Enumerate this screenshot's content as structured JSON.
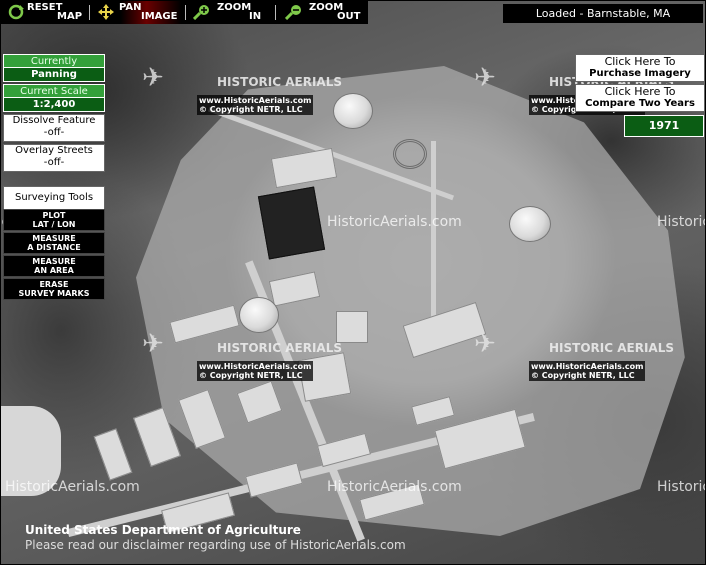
{
  "toolbar": {
    "reset": {
      "line1": "RESET",
      "line2": "MAP"
    },
    "pan": {
      "line1": "PAN",
      "line2": "IMAGE"
    },
    "zoom_in": {
      "line1": "ZOOM",
      "line2": "IN"
    },
    "zoom_out": {
      "line1": "ZOOM",
      "line2": "OUT"
    }
  },
  "status": {
    "loaded": "Loaded - Barnstable, MA"
  },
  "left_panel": {
    "currently_label": "Currently",
    "currently_value": "Panning",
    "scale_label": "Current Scale",
    "scale_value": "1:2,400",
    "dissolve_label": "Dissolve Feature",
    "dissolve_value": "-off-",
    "streets_label": "Overlay Streets",
    "streets_value": "-off-",
    "surveying_label": "Surveying Tools",
    "tools": [
      {
        "line1": "PLOT",
        "line2": "LAT / LON"
      },
      {
        "line1": "MEASURE",
        "line2": "A DISTANCE"
      },
      {
        "line1": "MEASURE",
        "line2": "AN AREA"
      },
      {
        "line1": "ERASE",
        "line2": "SURVEY MARKS"
      }
    ]
  },
  "right_panel": {
    "purchase": {
      "line1": "Click Here To",
      "line2": "Purchase Imagery"
    },
    "compare": {
      "line1": "Click Here To",
      "line2": "Compare Two Years"
    },
    "year": "1971"
  },
  "watermark": {
    "brand": "HISTORIC AERIALS",
    "site": "www.HistoricAerials.com",
    "copyright": "© Copyright NETR, LLC",
    "big_text": "HistoricAerials.com",
    "big_text_cut": "Historic"
  },
  "footer": {
    "usda": "United States Department of Agriculture",
    "disclaimer": "Please read our disclaimer regarding use of HistoricAerials.com"
  },
  "colors": {
    "green_dark": "#0b5d14",
    "green_light": "#33a03a",
    "toolbar": "#000000"
  }
}
